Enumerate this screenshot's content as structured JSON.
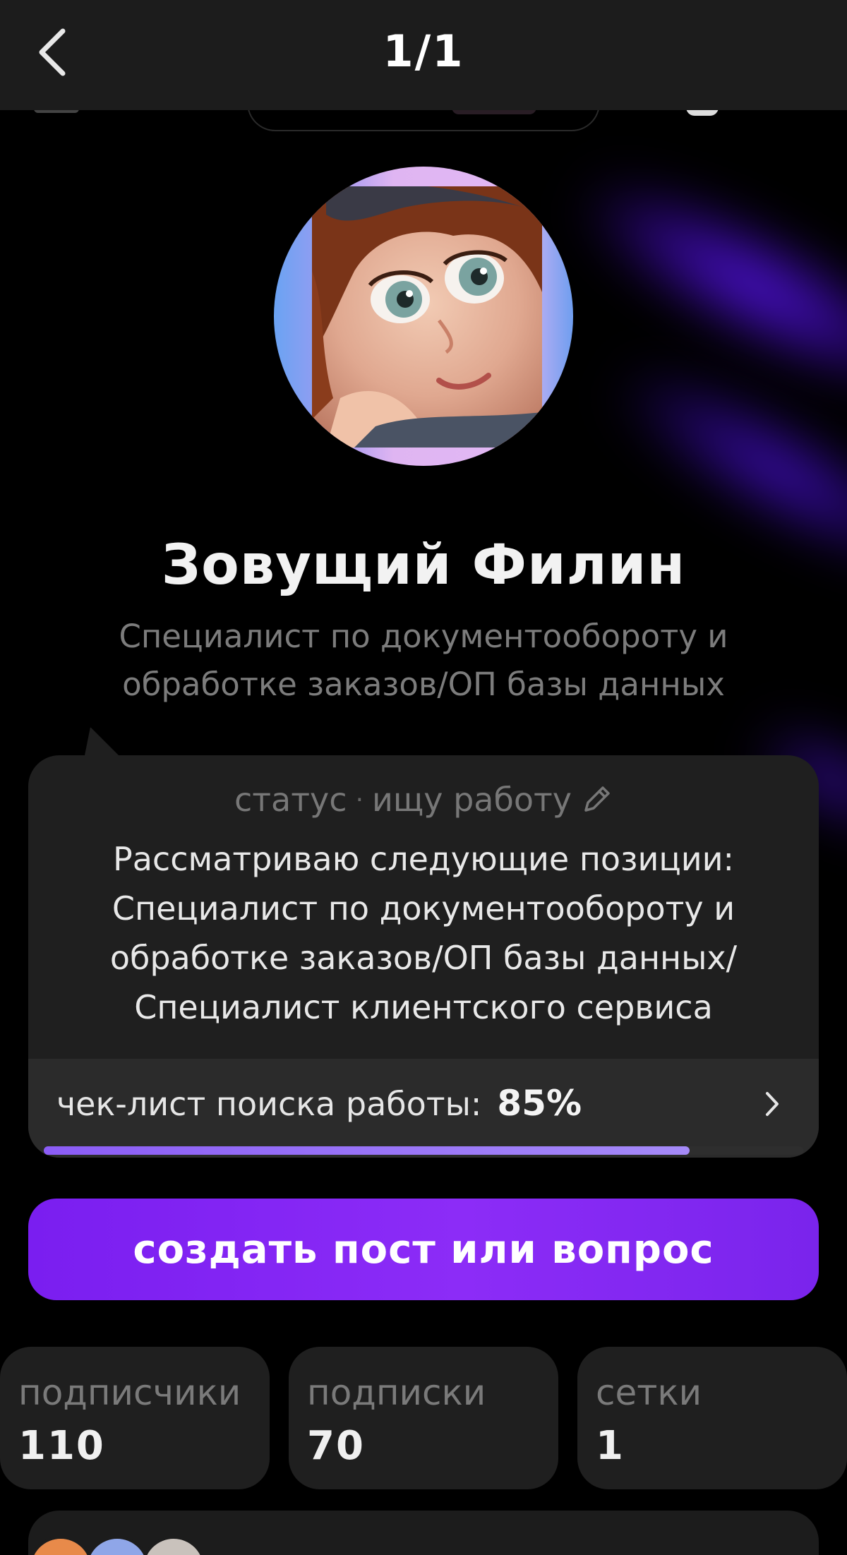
{
  "topbar": {
    "counter": "1/1"
  },
  "profile": {
    "name": "Зовущий Филин",
    "title": "Специалист по документообороту и обработке заказов/ОП базы данных"
  },
  "status": {
    "label": "статус",
    "separator": "·",
    "value": "ищу работу",
    "text": "Рассматриваю следующие позиции: Специалист по документообороту и обработке заказов/ОП базы данных/ Специалист клиентского сервиса"
  },
  "checklist": {
    "label": "чек-лист поиска работы:",
    "value": "85%",
    "progress_fraction": 0.85
  },
  "cta": {
    "label": "создать пост или вопрос"
  },
  "stats": [
    {
      "label": "подписчики",
      "value": "110"
    },
    {
      "label": "подписки",
      "value": "70"
    },
    {
      "label": "сетки",
      "value": "1"
    }
  ],
  "colors": {
    "accent": "#7a1ef0",
    "progress": "#8b5cf6",
    "card": "#1f1f1f",
    "background": "#000000"
  },
  "icons": {
    "back": "chevron-left-icon",
    "edit": "pencil-icon",
    "open": "chevron-right-icon"
  }
}
